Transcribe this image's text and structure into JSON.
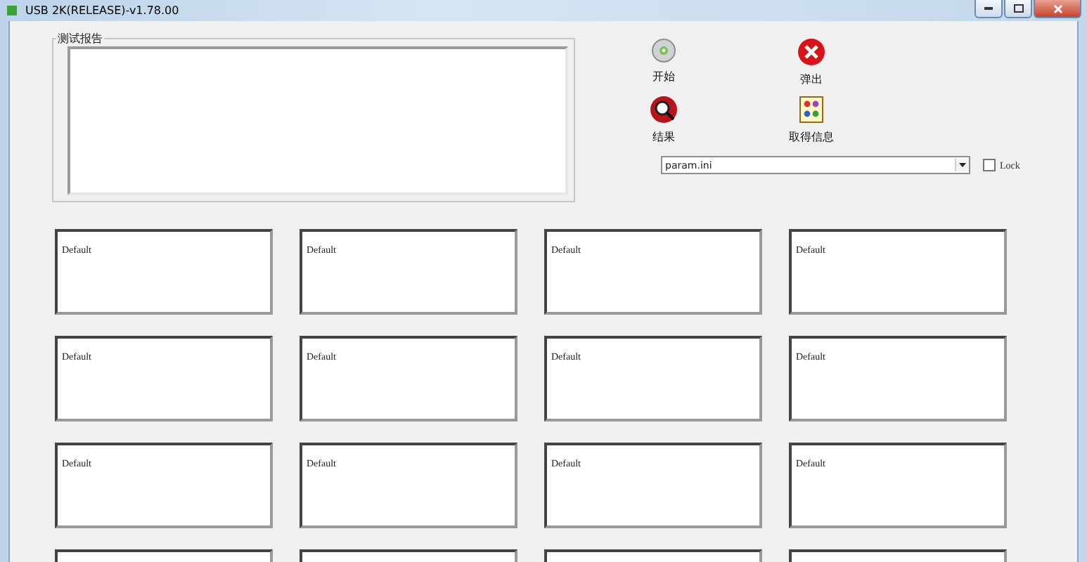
{
  "window": {
    "title": "USB 2K(RELEASE)-v1.78.00"
  },
  "report": {
    "title": "测试报告"
  },
  "actions": [
    {
      "kind": "start",
      "label": "开始"
    },
    {
      "kind": "eject",
      "label": "弹出"
    },
    {
      "kind": "result",
      "label": "结果"
    },
    {
      "kind": "info",
      "label": "取得信息"
    }
  ],
  "config": {
    "value": "param.ini",
    "lock": {
      "label": "Lock",
      "checked": false
    }
  },
  "slots": [
    {
      "kind": "labeled",
      "label": "Default"
    },
    {
      "kind": "labeled",
      "label": "Default"
    },
    {
      "kind": "labeled",
      "label": "Default"
    },
    {
      "kind": "labeled",
      "label": "Default"
    },
    {
      "kind": "labeled",
      "label": "Default"
    },
    {
      "kind": "labeled",
      "label": "Default"
    },
    {
      "kind": "labeled",
      "label": "Default"
    },
    {
      "kind": "labeled",
      "label": "Default"
    },
    {
      "kind": "labeled",
      "label": "Default"
    },
    {
      "kind": "labeled",
      "label": "Default"
    },
    {
      "kind": "labeled",
      "label": "Default"
    },
    {
      "kind": "labeled",
      "label": "Default"
    },
    {
      "kind": "blank"
    },
    {
      "kind": "blank"
    },
    {
      "kind": "blank"
    },
    {
      "kind": "blank"
    }
  ]
}
